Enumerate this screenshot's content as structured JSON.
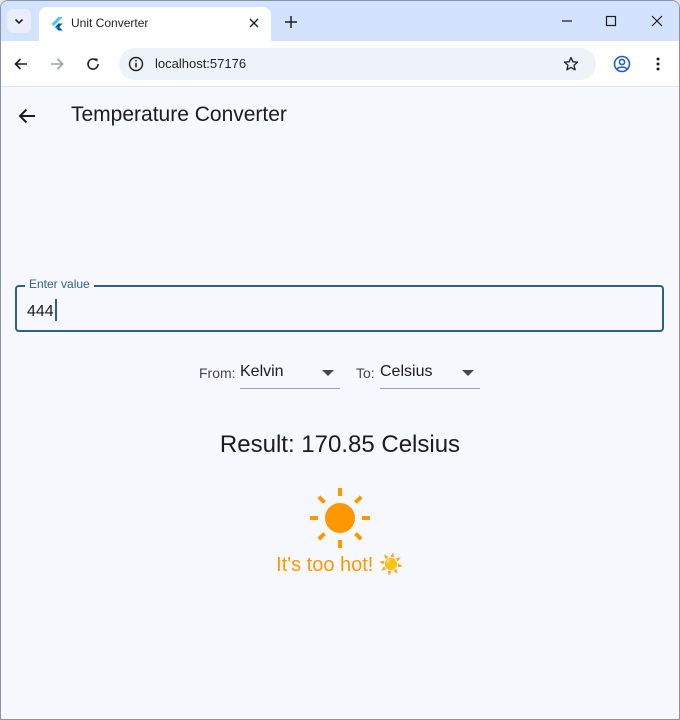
{
  "browser": {
    "tab_title": "Unit Converter",
    "url": "localhost:57176"
  },
  "app": {
    "title": "Temperature Converter",
    "input": {
      "label": "Enter value",
      "value": "444"
    },
    "from": {
      "label": "From:",
      "selected": "Kelvin"
    },
    "to": {
      "label": "To:",
      "selected": "Celsius"
    },
    "result_text": "Result: 170.85 Celsius",
    "status_message": "It's too hot! ☀️",
    "status_icon": "sun-icon",
    "accent_color": "#ff9800",
    "primary_color": "#2f5f86"
  }
}
